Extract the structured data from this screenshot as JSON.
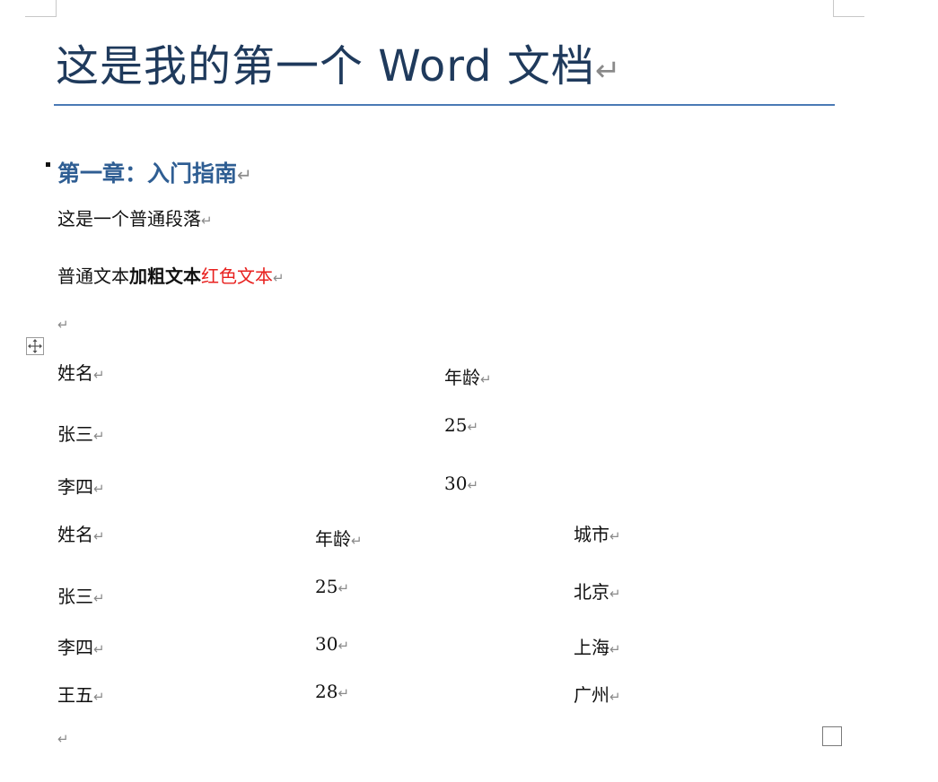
{
  "pilcrow": "↵",
  "document": {
    "title": "这是我的第一个 Word 文档",
    "heading": "第一章：入门指南",
    "paragraph1": "这是一个普通段落",
    "paragraph2": {
      "normal": "普通文本",
      "bold": "加粗文本",
      "red": "红色文本"
    }
  },
  "table1": {
    "rows": [
      [
        "姓名",
        "年龄"
      ],
      [
        "张三",
        "25"
      ],
      [
        "李四",
        "30"
      ]
    ]
  },
  "table2": {
    "rows": [
      [
        "姓名",
        "年龄",
        "城市"
      ],
      [
        "张三",
        "25",
        "北京"
      ],
      [
        "李四",
        "30",
        "上海"
      ],
      [
        "王五",
        "28",
        "广州"
      ]
    ]
  },
  "colors": {
    "title": "#1f3a5c",
    "heading": "#2f5e93",
    "red_text": "#e8201e",
    "rule": "#4a7ab5"
  },
  "icons": {
    "table_move_handle": "move-arrows-icon",
    "table_resize_handle": "resize-square-icon"
  }
}
